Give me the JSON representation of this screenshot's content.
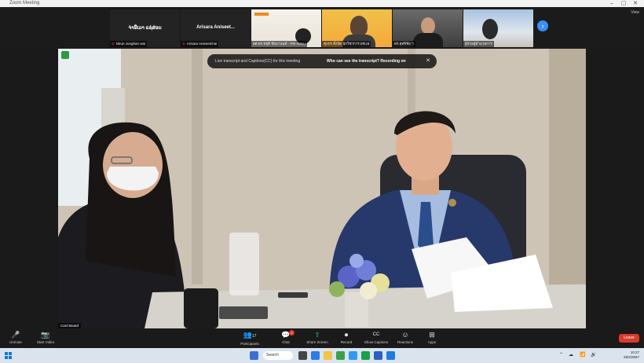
{
  "window": {
    "title": "Zoom Meeting",
    "controls": [
      "–",
      "▢",
      "✕"
    ]
  },
  "strip": {
    "view_label": "View",
    "next_symbol": "›",
    "tiles": [
      {
        "type": "name",
        "name": "ຈ່າພີ່ເລາ ແຊ່ສ່ອນ",
        "label": "Nirun Jonghan wai"
      },
      {
        "type": "name",
        "name": "Arisara Aniseet...",
        "label": "Arisara Aniseetchai"
      },
      {
        "type": "video",
        "label": "ผศ.ดร.ชยุติ ชัยมานนท์ - PM manu"
      },
      {
        "type": "video",
        "label": "ศุภกร ตั้งจิต นักวิชาการ ผช.เอ"
      },
      {
        "type": "video",
        "label": "ดร.สุทธิชัย ฯ"
      },
      {
        "type": "video",
        "label": "ผู้ช่วยผู้อำนวยการ"
      }
    ]
  },
  "main": {
    "banner_text": "Live transcript and Captions(CC) for this meeting",
    "banner_question": "Who can see the transcript? Recording on",
    "banner_close": "✕",
    "speaker_label": "Card Board"
  },
  "toolbar": {
    "left": [
      {
        "icon": "🎤",
        "label": "Unmute"
      },
      {
        "icon": "📷",
        "label": "Start Video"
      }
    ],
    "center": [
      {
        "icon": "👥",
        "label": "Participants",
        "count": "17"
      },
      {
        "icon": "💬",
        "label": "Chat",
        "badge": "2"
      },
      {
        "icon": "⇧",
        "label": "Share Screen"
      },
      {
        "icon": "⏺",
        "label": "Record"
      },
      {
        "icon": "CC",
        "label": "Show Captions"
      },
      {
        "icon": "☺",
        "label": "Reactions"
      },
      {
        "icon": "⊞",
        "label": "Apps"
      }
    ],
    "leave_label": "Leave"
  },
  "taskbar": {
    "search_label": "Search",
    "tray_time": "10:27",
    "tray_date": "28/2/2567",
    "tray_icons": [
      "⌃",
      "☁",
      "📶",
      "🔊"
    ]
  },
  "colors": {
    "accent": "#3a8ef6",
    "leave": "#d93a2c",
    "share": "#2fbf58"
  }
}
